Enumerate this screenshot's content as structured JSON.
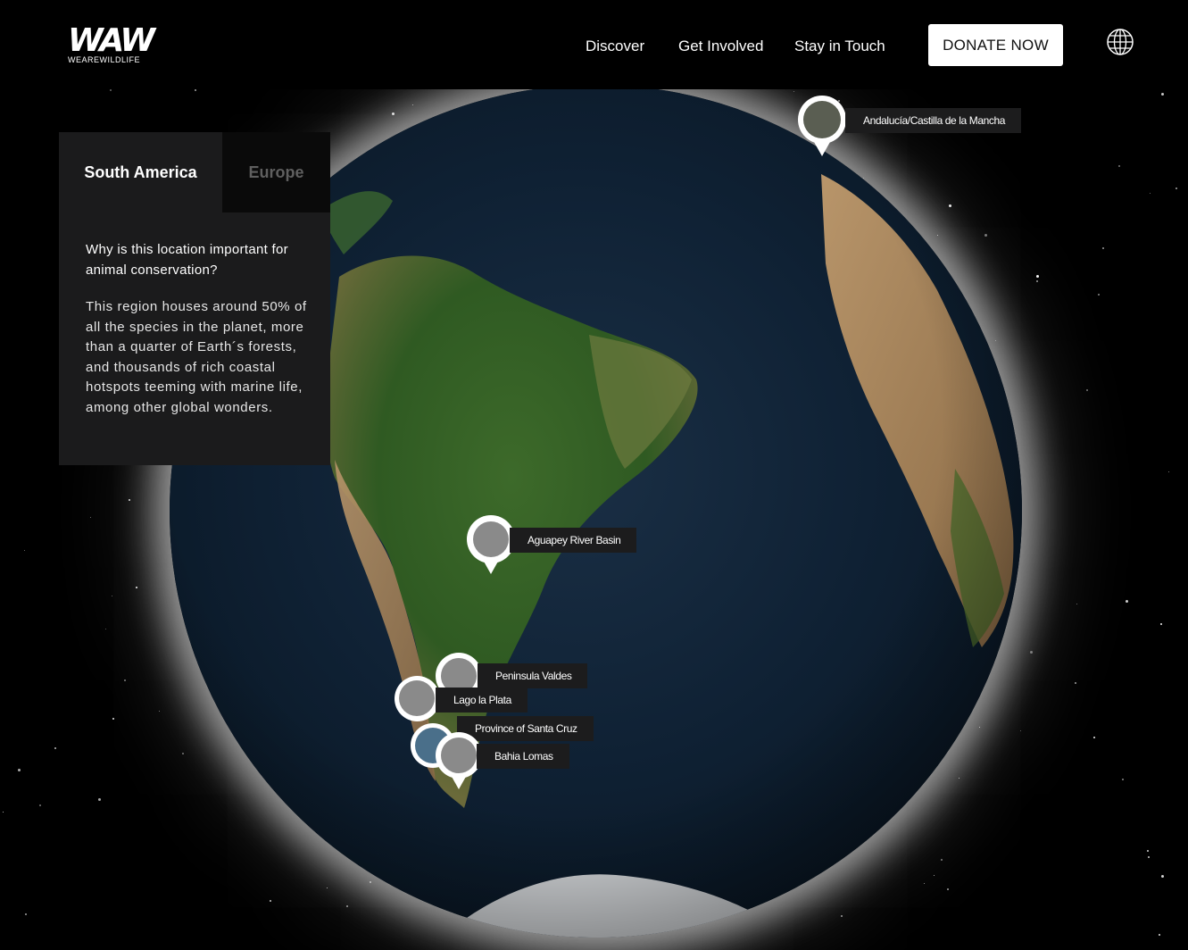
{
  "header": {
    "logo_mark": "WAW",
    "logo_sub": "WEAREWILDLIFE",
    "nav": [
      "Discover",
      "Get Involved",
      "Stay in Touch"
    ],
    "donate_label": "DONATE NOW",
    "language_icon": "globe-icon"
  },
  "panel": {
    "tabs": [
      {
        "label": "South America",
        "active": true
      },
      {
        "label": "Europe",
        "active": false
      }
    ],
    "question": "Why is this location important for animal conservation?",
    "answer": "This region houses around 50% of all the species in the planet, more than a quarter of Earth´s forests, and thousands of rich coastal hotspots teeming with marine life, among other global wonders."
  },
  "markers": [
    {
      "label": "Andalucía/Castilla de la Mancha"
    },
    {
      "label": "Aguapey River Basin"
    },
    {
      "label": "Peninsula Valdes"
    },
    {
      "label": "Lago la Plata"
    },
    {
      "label": "Province of Santa Cruz"
    },
    {
      "label": "Bahia Lomas"
    }
  ],
  "colors": {
    "background": "#000000",
    "panel": "#1b1b1c",
    "inactive_tab": "#0a0a0a",
    "donate_bg": "#ffffff"
  }
}
